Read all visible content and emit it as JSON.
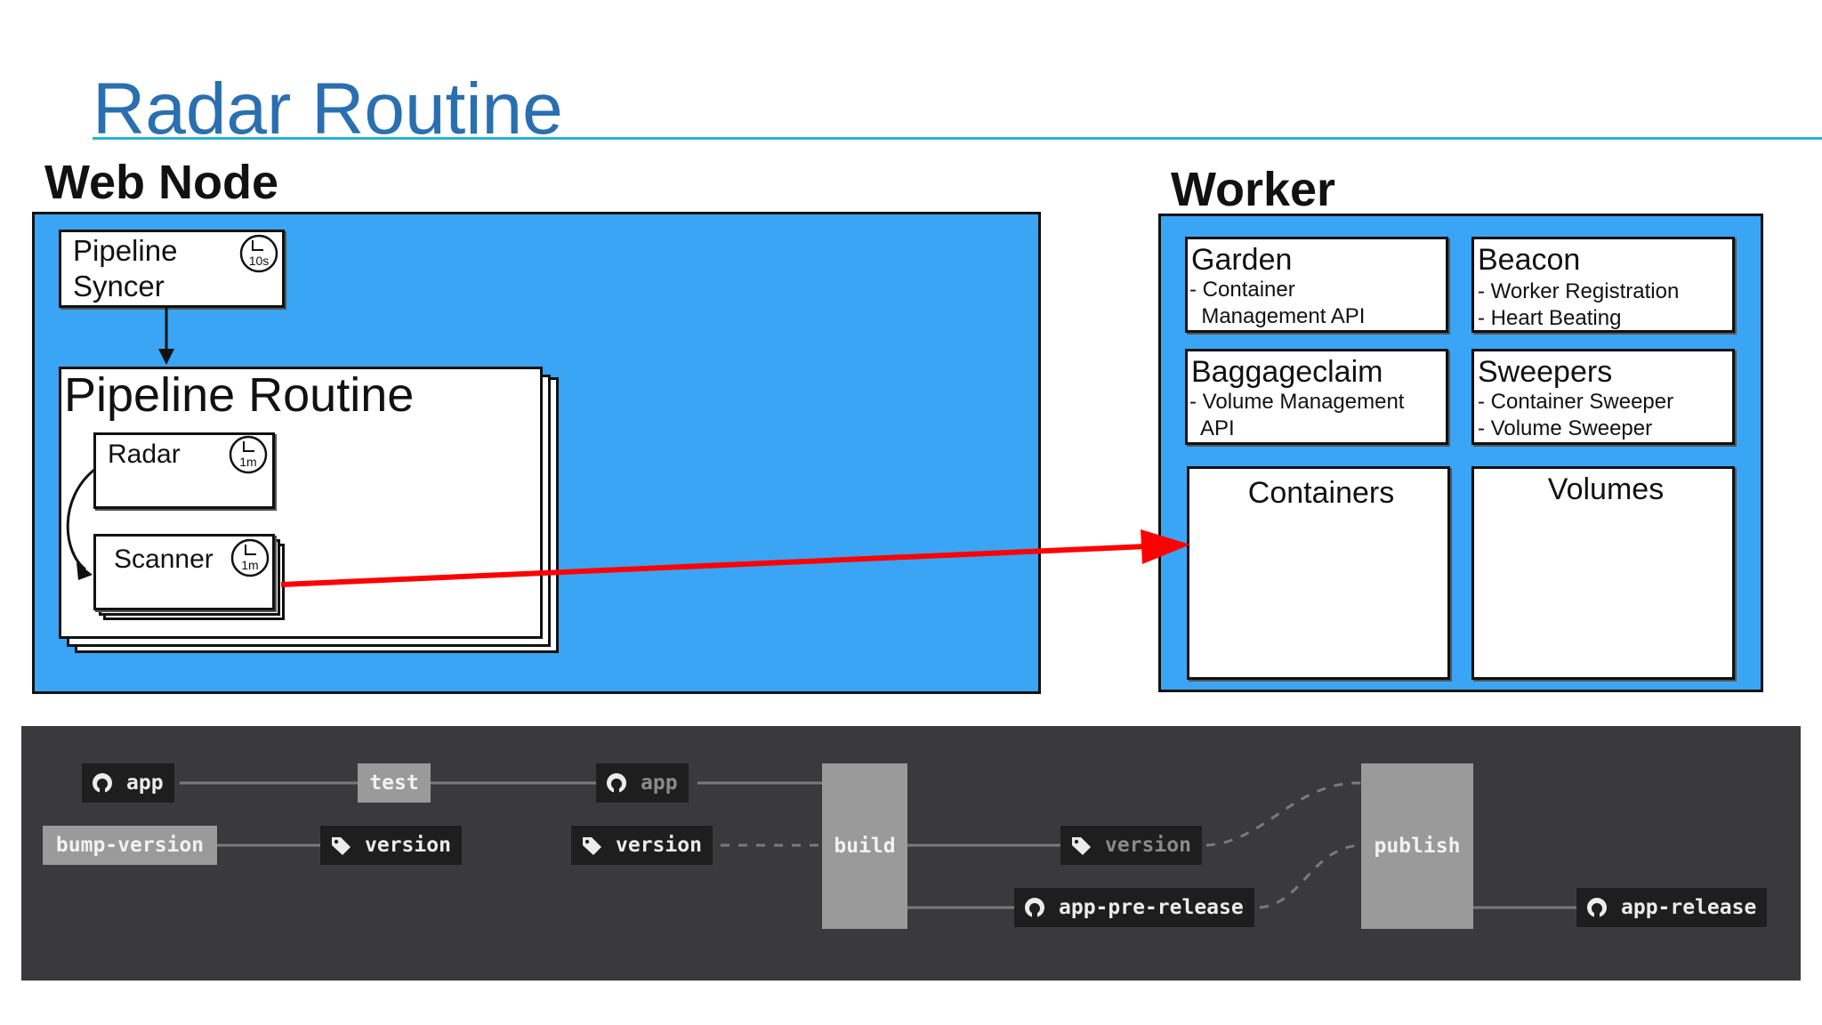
{
  "slide": {
    "title": "Radar Routine"
  },
  "web_node": {
    "label": "Web Node",
    "pipeline_syncer": {
      "label": "Pipeline Syncer",
      "interval": "10s"
    },
    "pipeline_routine": {
      "label": "Pipeline Routine"
    },
    "radar": {
      "label": "Radar",
      "interval": "1m"
    },
    "scanner": {
      "label": "Scanner",
      "interval": "1m"
    }
  },
  "worker": {
    "label": "Worker",
    "garden": {
      "title": "Garden",
      "lines": [
        "- Container",
        "  Management API"
      ]
    },
    "beacon": {
      "title": "Beacon",
      "lines": [
        "- Worker Registration",
        "- Heart Beating"
      ]
    },
    "baggageclaim": {
      "title": "Baggageclaim",
      "lines": [
        "- Volume Management",
        "  API"
      ]
    },
    "sweepers": {
      "title": "Sweepers",
      "lines": [
        "- Container Sweeper",
        "- Volume Sweeper"
      ]
    },
    "containers": {
      "title": "Containers"
    },
    "volumes": {
      "title": "Volumes"
    }
  },
  "pipeline": {
    "nodes": {
      "app_in": {
        "label": "app",
        "icon": "github-icon"
      },
      "bump_version": {
        "label": "bump-version"
      },
      "test": {
        "label": "test"
      },
      "version_1": {
        "label": "version",
        "icon": "tag-icon"
      },
      "app_mid": {
        "label": "app",
        "icon": "github-icon"
      },
      "version_2": {
        "label": "version",
        "icon": "tag-icon"
      },
      "build": {
        "label": "build"
      },
      "version_out": {
        "label": "version",
        "icon": "tag-icon"
      },
      "app_pre_release": {
        "label": "app-pre-release",
        "icon": "github-icon"
      },
      "publish": {
        "label": "publish"
      },
      "app_release": {
        "label": "app-release",
        "icon": "github-icon"
      }
    }
  },
  "colors": {
    "title": "#2a6fb0",
    "title_rule": "#2bb0d6",
    "region_fill": "#3aa5f5",
    "arrow_red": "#ff0000",
    "pipeline_bg": "#3a3a3c",
    "resource_bg": "#1e1e1e",
    "job_bg": "#9a9a9a"
  }
}
